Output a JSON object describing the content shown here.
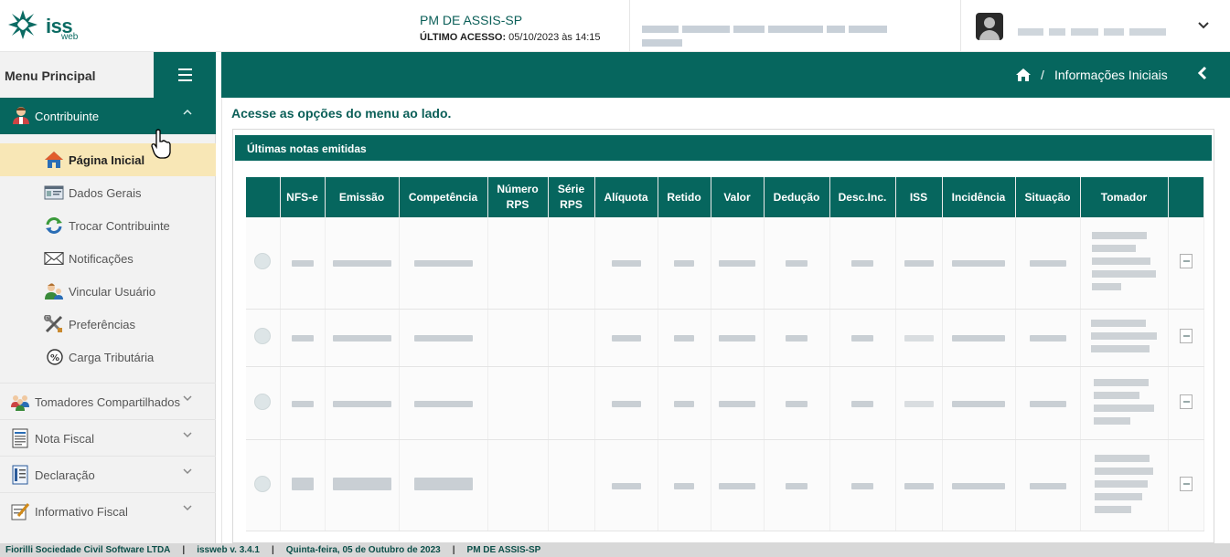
{
  "header": {
    "logo_text": "iss",
    "logo_sub": "web",
    "pm_title": "PM DE ASSIS-SP",
    "last_access_label": "ÚLTIMO ACESSO:",
    "last_access_value": "05/10/2023 às 14:15",
    "user_menu_icon": "chevron-down-icon"
  },
  "sidebar": {
    "title": "Menu Principal",
    "toggle_icon": "hamburger-icon",
    "contribuinte": {
      "label": "Contribuinte",
      "icon": "taxpayer-icon",
      "expanded": true
    },
    "submenu": [
      {
        "label": "Página Inicial",
        "icon": "home-icon",
        "active": true
      },
      {
        "label": "Dados Gerais",
        "icon": "id-card-icon",
        "active": false
      },
      {
        "label": "Trocar Contribuinte",
        "icon": "swap-icon",
        "active": false
      },
      {
        "label": "Notificações",
        "icon": "envelope-icon",
        "active": false
      },
      {
        "label": "Vincular Usuário",
        "icon": "users-link-icon",
        "active": false
      },
      {
        "label": "Preferências",
        "icon": "tools-icon",
        "active": false
      },
      {
        "label": "Carga Tributária",
        "icon": "percent-icon",
        "active": false
      }
    ],
    "sections": [
      {
        "label": "Tomadores Compartilhados",
        "icon": "shared-users-icon"
      },
      {
        "label": "Nota Fiscal",
        "icon": "invoice-icon"
      },
      {
        "label": "Declaração",
        "icon": "declaration-icon"
      },
      {
        "label": "Informativo Fiscal",
        "icon": "note-pencil-icon"
      }
    ]
  },
  "breadcrumb": {
    "home_icon": "home-icon",
    "separator": "/",
    "page": "Informações Iniciais",
    "back_icon": "chevron-left-icon"
  },
  "main": {
    "intro": "Acesse as opções do menu ao lado.",
    "panel_title": "Últimas notas emitidas",
    "table": {
      "columns": [
        "",
        "NFS-e",
        "Emissão",
        "Competência",
        "Número RPS",
        "Série RPS",
        "Alíquota",
        "Retido",
        "Valor",
        "Dedução",
        "Desc.Inc.",
        "ISS",
        "Incidência",
        "Situação",
        "Tomador",
        ""
      ],
      "row_count": 4
    }
  },
  "footer": {
    "company": "Fiorilli Sociedade Civil Software LTDA",
    "version": "issweb v. 3.4.1",
    "date": "Quinta-feira, 05 de Outubro de 2023",
    "pm": "PM DE ASSIS-SP"
  },
  "colors": {
    "primary": "#06665e",
    "active_item": "#f8e7b6",
    "sidebar_bg": "#f2f2f2"
  }
}
